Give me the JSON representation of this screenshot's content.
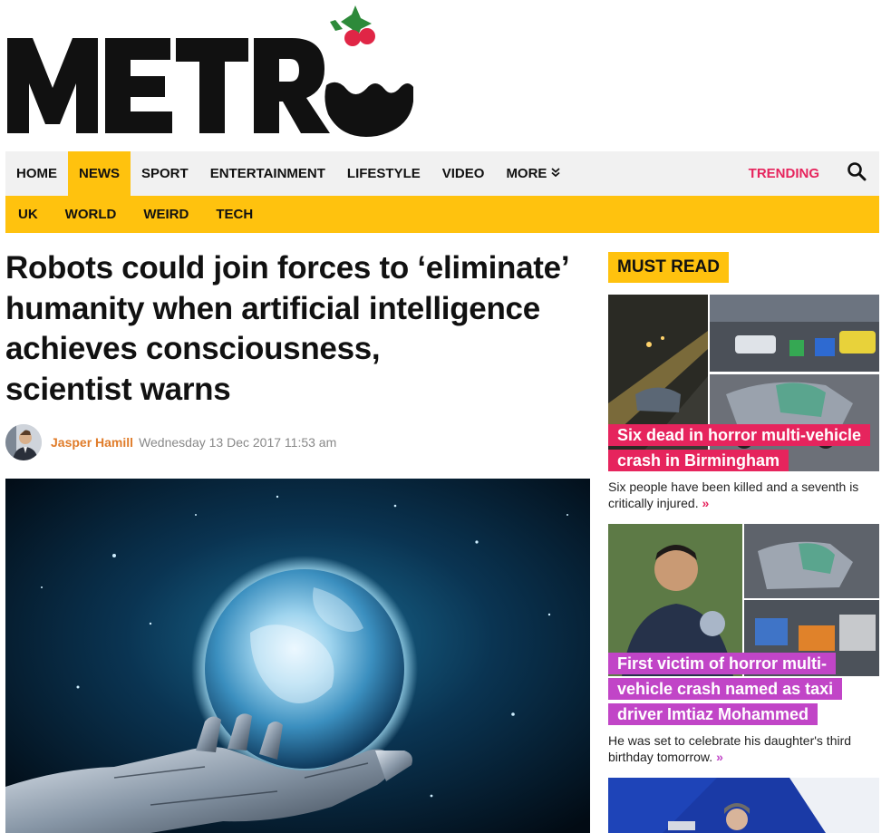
{
  "logo": {
    "text": "METRO"
  },
  "nav": {
    "items": [
      {
        "label": "HOME",
        "active": false
      },
      {
        "label": "NEWS",
        "active": true
      },
      {
        "label": "SPORT",
        "active": false
      },
      {
        "label": "ENTERTAINMENT",
        "active": false
      },
      {
        "label": "LIFESTYLE",
        "active": false
      },
      {
        "label": "VIDEO",
        "active": false
      },
      {
        "label": "MORE",
        "active": false
      }
    ],
    "more_icon": "chevron-double-down-icon",
    "trending": "TRENDING",
    "search_icon": "search-icon"
  },
  "subnav": {
    "items": [
      "UK",
      "WORLD",
      "WEIRD",
      "TECH"
    ]
  },
  "article": {
    "headline_lines": [
      "Robots could join forces to ‘eliminate’",
      "humanity when artificial intelligence",
      "achieves consciousness,",
      "scientist warns"
    ],
    "author": "Jasper Hamill",
    "date": "Wednesday 13 Dec 2017 11:53 am"
  },
  "sidebar": {
    "heading": "MUST READ",
    "cards": [
      {
        "title_lines": [
          "Six dead in horror multi-vehicle",
          "crash in Birmingham"
        ],
        "summary": "Six people have been killed and a seventh is critically injured.",
        "arrow": "»"
      },
      {
        "title_lines": [
          "First victim of horror multi-",
          "vehicle crash named as taxi",
          "driver Imtiaz Mohammed"
        ],
        "summary": "He was set to celebrate his daughter's third birthday tomorrow.",
        "arrow": "»"
      }
    ]
  },
  "colors": {
    "brand_yellow": "#ffc20e",
    "trending_pink": "#e6245d",
    "card_pink": "#e6245d",
    "card_purple": "#c145c7",
    "author_orange": "#e07c2a"
  }
}
